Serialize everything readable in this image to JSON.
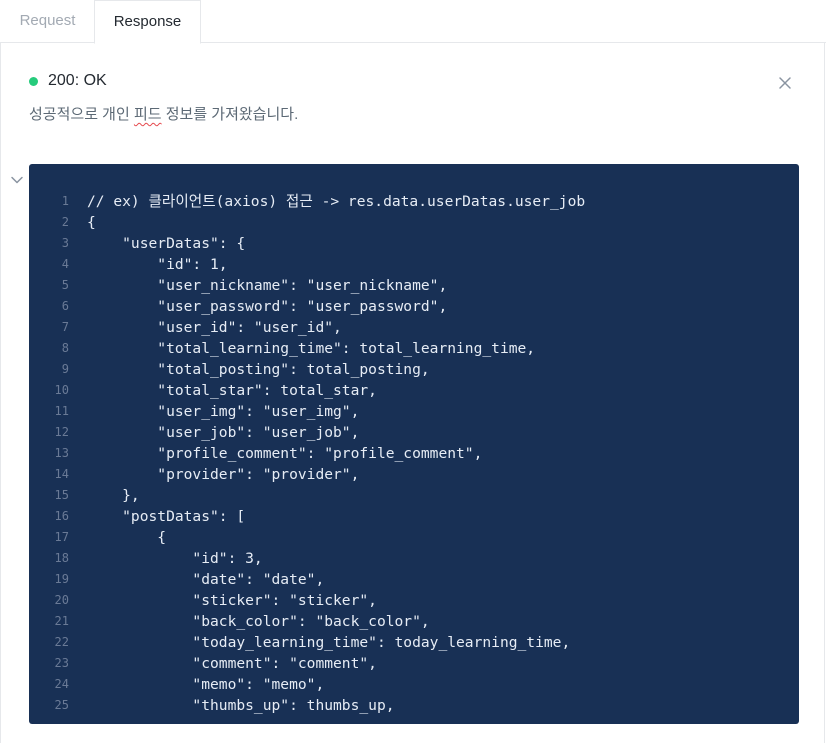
{
  "tabs": [
    {
      "label": "Request",
      "active": false
    },
    {
      "label": "Response",
      "active": true
    }
  ],
  "response": {
    "status": "200: OK",
    "status_color": "#26cb7c",
    "description_before": "성공적으로 개인 ",
    "description_highlight": "피드",
    "description_after": " 정보를 가져왔습니다.",
    "close_icon": "close-icon",
    "collapse_icon": "chevron-down-icon"
  },
  "code": {
    "background": "#183055",
    "lines": [
      {
        "n": "1",
        "text": "// ex) 클라이언트(axios) 접근 -> res.data.userDatas.user_job"
      },
      {
        "n": "2",
        "text": "{"
      },
      {
        "n": "3",
        "text": "    \"userDatas\": {"
      },
      {
        "n": "4",
        "text": "        \"id\": 1,"
      },
      {
        "n": "5",
        "text": "        \"user_nickname\": \"user_nickname\","
      },
      {
        "n": "6",
        "text": "        \"user_password\": \"user_password\","
      },
      {
        "n": "7",
        "text": "        \"user_id\": \"user_id\","
      },
      {
        "n": "8",
        "text": "        \"total_learning_time\": total_learning_time,"
      },
      {
        "n": "9",
        "text": "        \"total_posting\": total_posting,"
      },
      {
        "n": "10",
        "text": "        \"total_star\": total_star,"
      },
      {
        "n": "11",
        "text": "        \"user_img\": \"user_img\","
      },
      {
        "n": "12",
        "text": "        \"user_job\": \"user_job\","
      },
      {
        "n": "13",
        "text": "        \"profile_comment\": \"profile_comment\","
      },
      {
        "n": "14",
        "text": "        \"provider\": \"provider\","
      },
      {
        "n": "15",
        "text": "    },"
      },
      {
        "n": "16",
        "text": "    \"postDatas\": ["
      },
      {
        "n": "17",
        "text": "        {"
      },
      {
        "n": "18",
        "text": "            \"id\": 3,"
      },
      {
        "n": "19",
        "text": "            \"date\": \"date\","
      },
      {
        "n": "20",
        "text": "            \"sticker\": \"sticker\","
      },
      {
        "n": "21",
        "text": "            \"back_color\": \"back_color\","
      },
      {
        "n": "22",
        "text": "            \"today_learning_time\": today_learning_time,"
      },
      {
        "n": "23",
        "text": "            \"comment\": \"comment\","
      },
      {
        "n": "24",
        "text": "            \"memo\": \"memo\","
      },
      {
        "n": "25",
        "text": "            \"thumbs_up\": thumbs_up,"
      }
    ]
  }
}
